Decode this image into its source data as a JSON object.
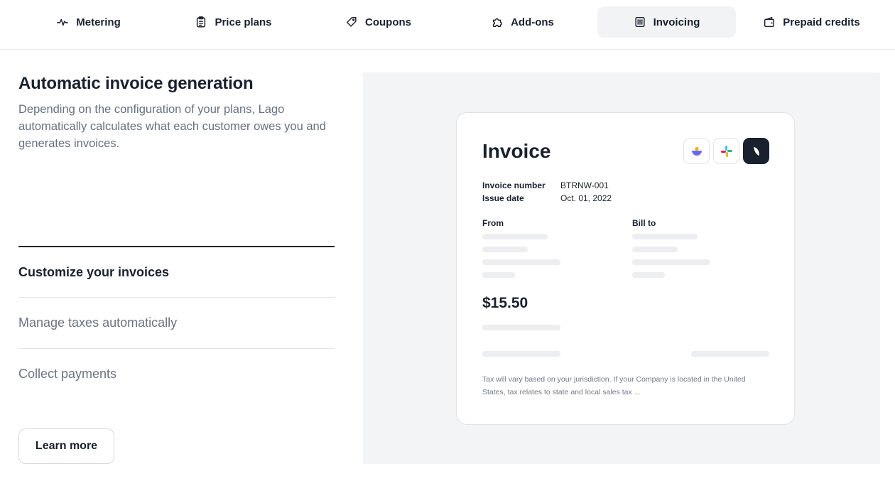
{
  "tabs": [
    {
      "label": "Metering",
      "icon": "pulse-icon"
    },
    {
      "label": "Price plans",
      "icon": "clipboard-icon"
    },
    {
      "label": "Coupons",
      "icon": "tag-icon"
    },
    {
      "label": "Add-ons",
      "icon": "puzzle-icon"
    },
    {
      "label": "Invoicing",
      "icon": "document-icon",
      "active": true
    },
    {
      "label": "Prepaid credits",
      "icon": "wallet-icon"
    }
  ],
  "main": {
    "heading": "Automatic invoice generation",
    "description": "Depending on the configuration of your plans, Lago automatically calculates what each customer owes you and generates invoices.",
    "features": [
      {
        "label": "Customize your invoices",
        "active": true
      },
      {
        "label": "Manage taxes automatically"
      },
      {
        "label": "Collect payments"
      }
    ],
    "learn_more": "Learn more"
  },
  "invoice": {
    "title": "Invoice",
    "number_label": "Invoice number",
    "number_value": "BTRNW-001",
    "date_label": "Issue date",
    "date_value": "Oct. 01, 2022",
    "from_label": "From",
    "bill_to_label": "Bill to",
    "amount": "$15.50",
    "note": "Tax will vary based on your jurisdiction. If your Company is located in the United States, tax relates to state and local sales tax ..."
  },
  "colors": {
    "accent": "#19212e",
    "muted": "#66707f",
    "panel": "#f3f4f6"
  }
}
